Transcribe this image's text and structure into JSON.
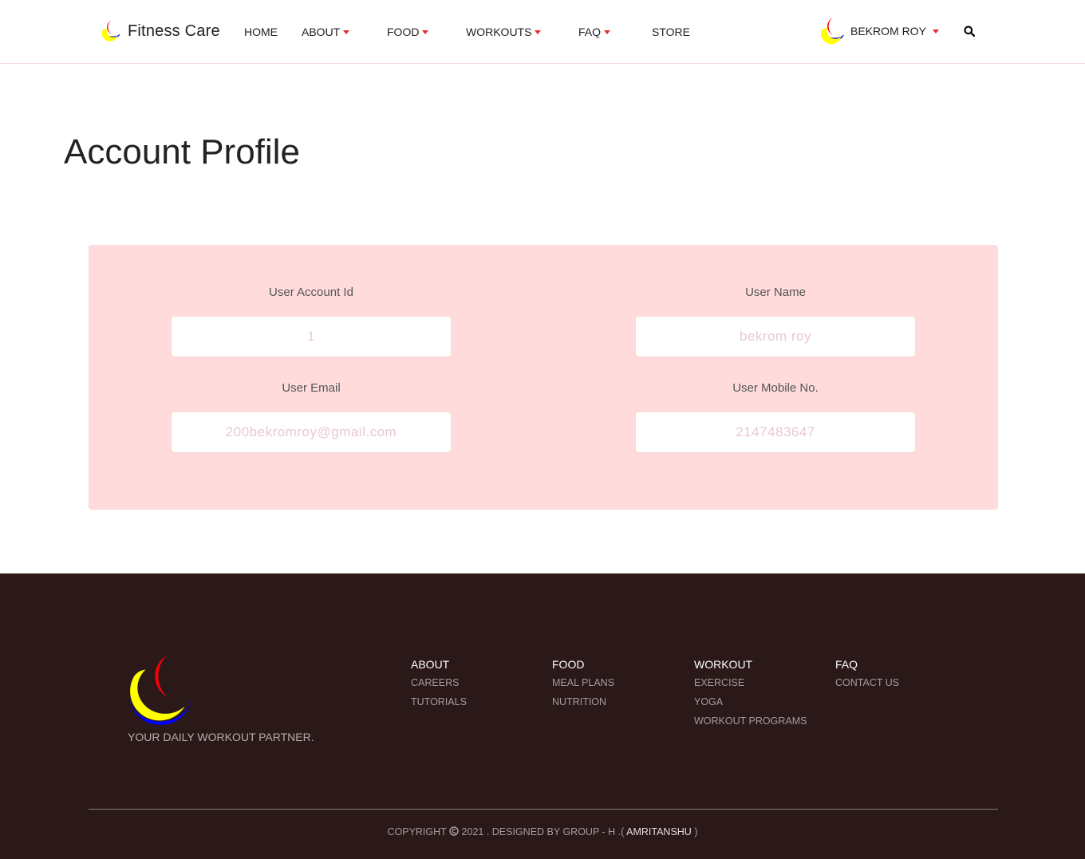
{
  "header": {
    "brand_name": "Fitness Care",
    "nav": [
      {
        "label": "HOME"
      },
      {
        "label": "ABOUT"
      },
      {
        "label": "FOOD"
      },
      {
        "label": "WORKOUTS"
      },
      {
        "label": "FAQ"
      },
      {
        "label": "STORE"
      }
    ],
    "user_name": "BEKROM ROY",
    "search_icon": "search-icon"
  },
  "page": {
    "title": "Account Profile"
  },
  "profile": {
    "account_id_label": "User Account Id",
    "account_id_value": "1",
    "user_name_label": "User Name",
    "user_name_value": "bekrom roy",
    "email_label": "User Email",
    "email_value": "200bekromroy@gmail.com",
    "mobile_label": "User Mobile No.",
    "mobile_value": "2147483647"
  },
  "footer": {
    "tagline": "YOUR DAILY WORKOUT PARTNER.",
    "columns": [
      {
        "heading": "ABOUT",
        "links": [
          "CAREERS",
          "TUTORIALS"
        ]
      },
      {
        "heading": "FOOD",
        "links": [
          "MEAL PLANS",
          "NUTRITION"
        ]
      },
      {
        "heading": "WORKOUT",
        "links": [
          "EXERCISE",
          "YOGA",
          "WORKOUT PROGRAMS"
        ]
      },
      {
        "heading": "FAQ",
        "links": [
          "CONTACT US"
        ]
      }
    ],
    "copyright_prefix": "COPYRIGHT",
    "copyright_middle": "2021 . DESIGNED BY GROUP - H .(",
    "copyright_author": "AMRITANSHU",
    "copyright_suffix": ")"
  },
  "colors": {
    "accent_red": "#e52b2b",
    "card_bg": "#ffdbdb",
    "footer_bg": "#2b1818",
    "logo_red": "#ff0000",
    "logo_yellow": "#ffff00",
    "logo_blue": "#0000ff"
  }
}
